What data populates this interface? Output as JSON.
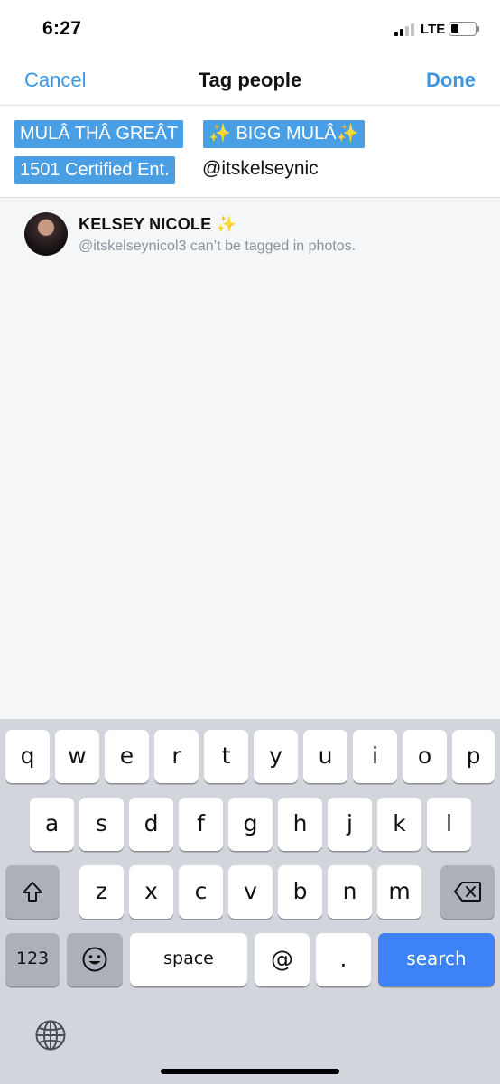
{
  "status": {
    "time": "6:27",
    "network": "LTE"
  },
  "nav": {
    "cancel": "Cancel",
    "title": "Tag people",
    "done": "Done"
  },
  "tags": {
    "chips": [
      "MULÂ THÂ GREÂT",
      "✨ BIGG MULÂ✨",
      "1501 Certified Ent."
    ],
    "input": "@itskelseynic"
  },
  "result": {
    "name": "KELSEY NICOLE ✨",
    "subtitle": "@itskelseynicol3 can’t be tagged in photos."
  },
  "keyboard": {
    "row1": [
      "q",
      "w",
      "e",
      "r",
      "t",
      "y",
      "u",
      "i",
      "o",
      "p"
    ],
    "row2": [
      "a",
      "s",
      "d",
      "f",
      "g",
      "h",
      "j",
      "k",
      "l"
    ],
    "row3": [
      "z",
      "x",
      "c",
      "v",
      "b",
      "n",
      "m"
    ],
    "numbers": "123",
    "space": "space",
    "at": "@",
    "dot": ".",
    "search": "search"
  },
  "icons": [
    "signal-icon",
    "battery-icon",
    "avatar",
    "shift-icon",
    "delete-icon",
    "emoji-icon",
    "globe-icon"
  ],
  "colors": {
    "accent": "#3d97e0",
    "chip": "#4a9fe4",
    "search_key": "#3e82f7"
  }
}
